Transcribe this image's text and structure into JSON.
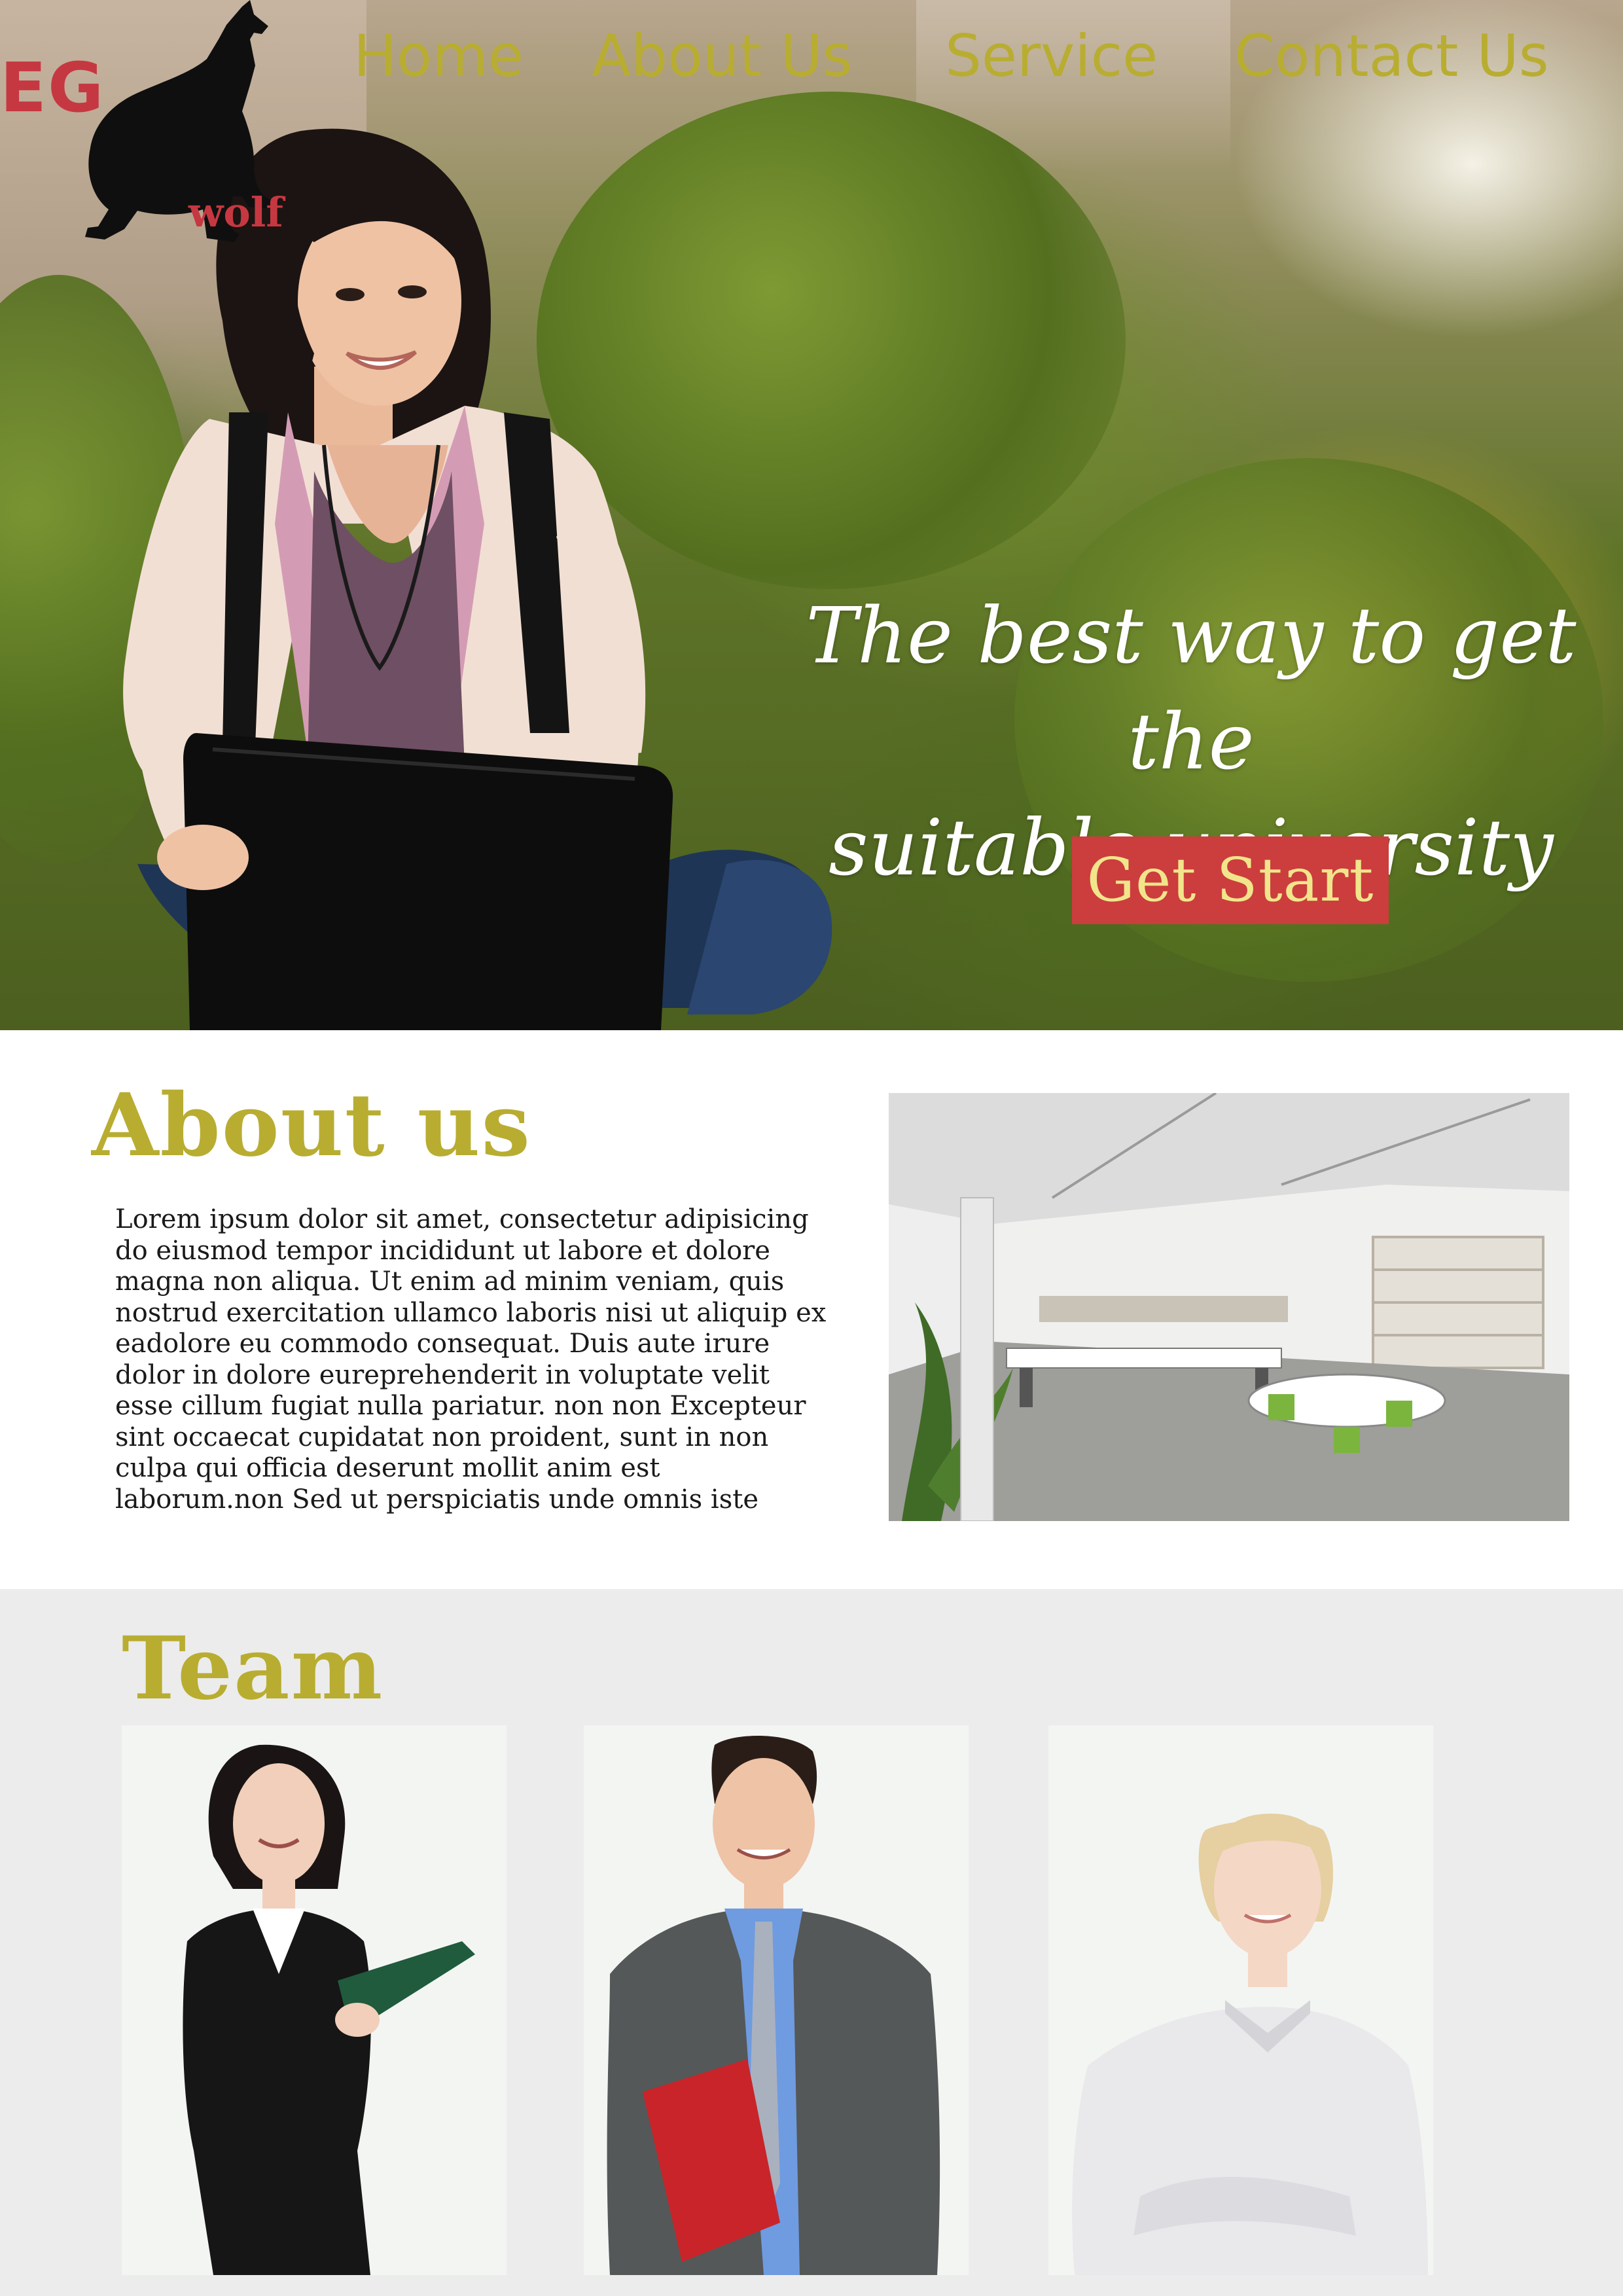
{
  "brand": {
    "logo_letters": "EG",
    "logo_word": "wolf",
    "logo_icon": "howling-wolf-icon",
    "accent_color": "#b8ad31",
    "brand_red": "#c63841"
  },
  "nav": {
    "items": [
      {
        "label": "Home"
      },
      {
        "label": "About Us"
      },
      {
        "label": "Service"
      },
      {
        "label": "Contact Us"
      }
    ]
  },
  "hero": {
    "tagline_line1": "The best way to get the",
    "tagline_line2": "suitable university",
    "cta_label": "Get Start",
    "cta_color": "#cc3d3d"
  },
  "about": {
    "title": "About us",
    "body": "Lorem ipsum dolor sit amet, consectetur adipisicing\ndo eiusmod tempor incididunt ut labore et dolore\nmagna non aliqua. Ut enim ad minim veniam, quis\nnostrud exercitation ullamco laboris nisi ut aliquip ex\neadolore eu commodo consequat. Duis aute irure\ndolor in dolore eureprehenderit in voluptate velit\nesse cillum  fugiat nulla pariatur. non non Excepteur\nsint occaecat cupidatat non proident, sunt in non\nculpa qui officia deserunt mollit anim  est\nlaborum.non  Sed ut perspiciatis unde omnis iste"
  },
  "team": {
    "title": "Team",
    "section_bg": "#ececec"
  }
}
